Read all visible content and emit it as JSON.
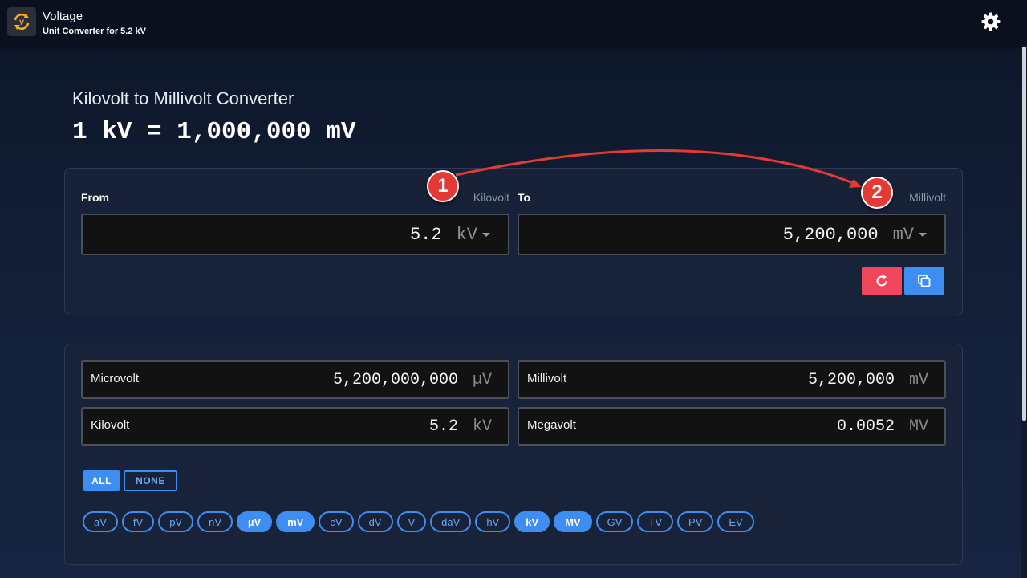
{
  "header": {
    "app_title": "Voltage",
    "app_subtitle": "Unit Converter for 5.2 kV",
    "icon": "sync-icon",
    "settings_icon": "gear-icon"
  },
  "converter": {
    "title": "Kilovolt to Millivolt Converter",
    "formula": "1 kV = 1,000,000 mV",
    "from": {
      "label": "From",
      "unit_name": "Kilovolt",
      "value": "5.2",
      "unit": "kV"
    },
    "to": {
      "label": "To",
      "unit_name": "Millivolt",
      "value": "5,200,000",
      "unit": "mV"
    },
    "reset_icon": "refresh-icon",
    "copy_icon": "copy-icon"
  },
  "annotations": {
    "badge1": "1",
    "badge2": "2",
    "color": "#e53935"
  },
  "results": [
    {
      "name": "Microvolt",
      "value": "5,200,000,000",
      "unit": "µV"
    },
    {
      "name": "Millivolt",
      "value": "5,200,000",
      "unit": "mV"
    },
    {
      "name": "Kilovolt",
      "value": "5.2",
      "unit": "kV"
    },
    {
      "name": "Megavolt",
      "value": "0.0052",
      "unit": "MV"
    }
  ],
  "selection": {
    "all": "ALL",
    "none": "NONE"
  },
  "units": [
    {
      "label": "aV",
      "active": false
    },
    {
      "label": "fV",
      "active": false
    },
    {
      "label": "pV",
      "active": false
    },
    {
      "label": "nV",
      "active": false
    },
    {
      "label": "µV",
      "active": true
    },
    {
      "label": "mV",
      "active": true
    },
    {
      "label": "cV",
      "active": false
    },
    {
      "label": "dV",
      "active": false
    },
    {
      "label": "V",
      "active": false
    },
    {
      "label": "daV",
      "active": false
    },
    {
      "label": "hV",
      "active": false
    },
    {
      "label": "kV",
      "active": true
    },
    {
      "label": "MV",
      "active": true
    },
    {
      "label": "GV",
      "active": false
    },
    {
      "label": "TV",
      "active": false
    },
    {
      "label": "PV",
      "active": false
    },
    {
      "label": "EV",
      "active": false
    }
  ],
  "colors": {
    "accent": "#3d8ef0",
    "reset": "#f0475d",
    "background": "#14213a"
  }
}
